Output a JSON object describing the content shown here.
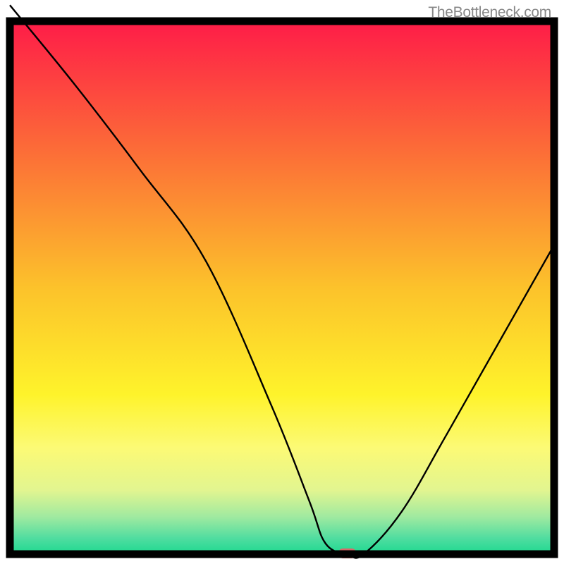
{
  "watermark": "TheBottleneck.com",
  "chart_data": {
    "type": "line",
    "title": "",
    "xlabel": "",
    "ylabel": "",
    "xlim": [
      0,
      100
    ],
    "ylim": [
      0,
      100
    ],
    "x": [
      0,
      12,
      24,
      36,
      48,
      55,
      58,
      62,
      65,
      72,
      80,
      90,
      100
    ],
    "values": [
      103,
      88,
      72,
      55,
      28,
      10,
      2,
      0,
      0,
      8,
      22,
      40,
      58
    ],
    "gradient_stops": [
      {
        "offset": 0,
        "color": "#fe1c48"
      },
      {
        "offset": 25,
        "color": "#fc6f37"
      },
      {
        "offset": 50,
        "color": "#fcc22b"
      },
      {
        "offset": 70,
        "color": "#fef32b"
      },
      {
        "offset": 80,
        "color": "#fcfa75"
      },
      {
        "offset": 88,
        "color": "#e2f590"
      },
      {
        "offset": 93,
        "color": "#a0eaa0"
      },
      {
        "offset": 97,
        "color": "#50dda0"
      },
      {
        "offset": 100,
        "color": "#1dd890"
      }
    ],
    "marker": {
      "x": 62,
      "y": 0,
      "color": "#d86868"
    }
  }
}
